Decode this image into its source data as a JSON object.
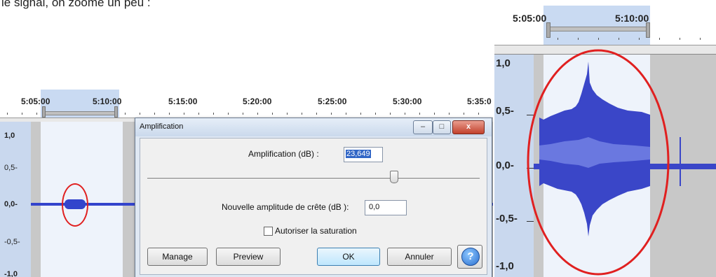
{
  "caption": "le signal, on zoome un peu :",
  "left": {
    "ruler_labels": [
      "5:05:00",
      "5:10:00",
      "5:15:00",
      "5:20:00",
      "5:25:00",
      "5:30:00",
      "5:35:0"
    ],
    "scale_labels": [
      "1,0",
      "0,5-",
      "0,0-",
      "-0,5-",
      "-1,0"
    ]
  },
  "dialog": {
    "title": "Amplification",
    "amp_label": "Amplification (dB) :",
    "amp_value": "23,649",
    "peak_label": "Nouvelle amplitude de crête (dB ):",
    "peak_value": "0,0",
    "saturation_label": "Autoriser la saturation",
    "saturation_checked": false,
    "slider_fraction": 0.74,
    "buttons": {
      "manage": "Manage",
      "preview": "Preview",
      "ok": "OK",
      "cancel": "Annuler",
      "help": "?"
    },
    "window_controls": {
      "minimize": "–",
      "maximize": "□",
      "close": "x"
    }
  },
  "zoom": {
    "ruler_labels": [
      "5:05:00",
      "5:10:00"
    ],
    "scale_labels": [
      "1,0",
      "0,5-",
      "0,0-",
      "-0,5-",
      "-1,0"
    ]
  },
  "colors": {
    "waveform": "#3344cc",
    "selection": "#c9daf2",
    "annotation": "#e02020"
  }
}
